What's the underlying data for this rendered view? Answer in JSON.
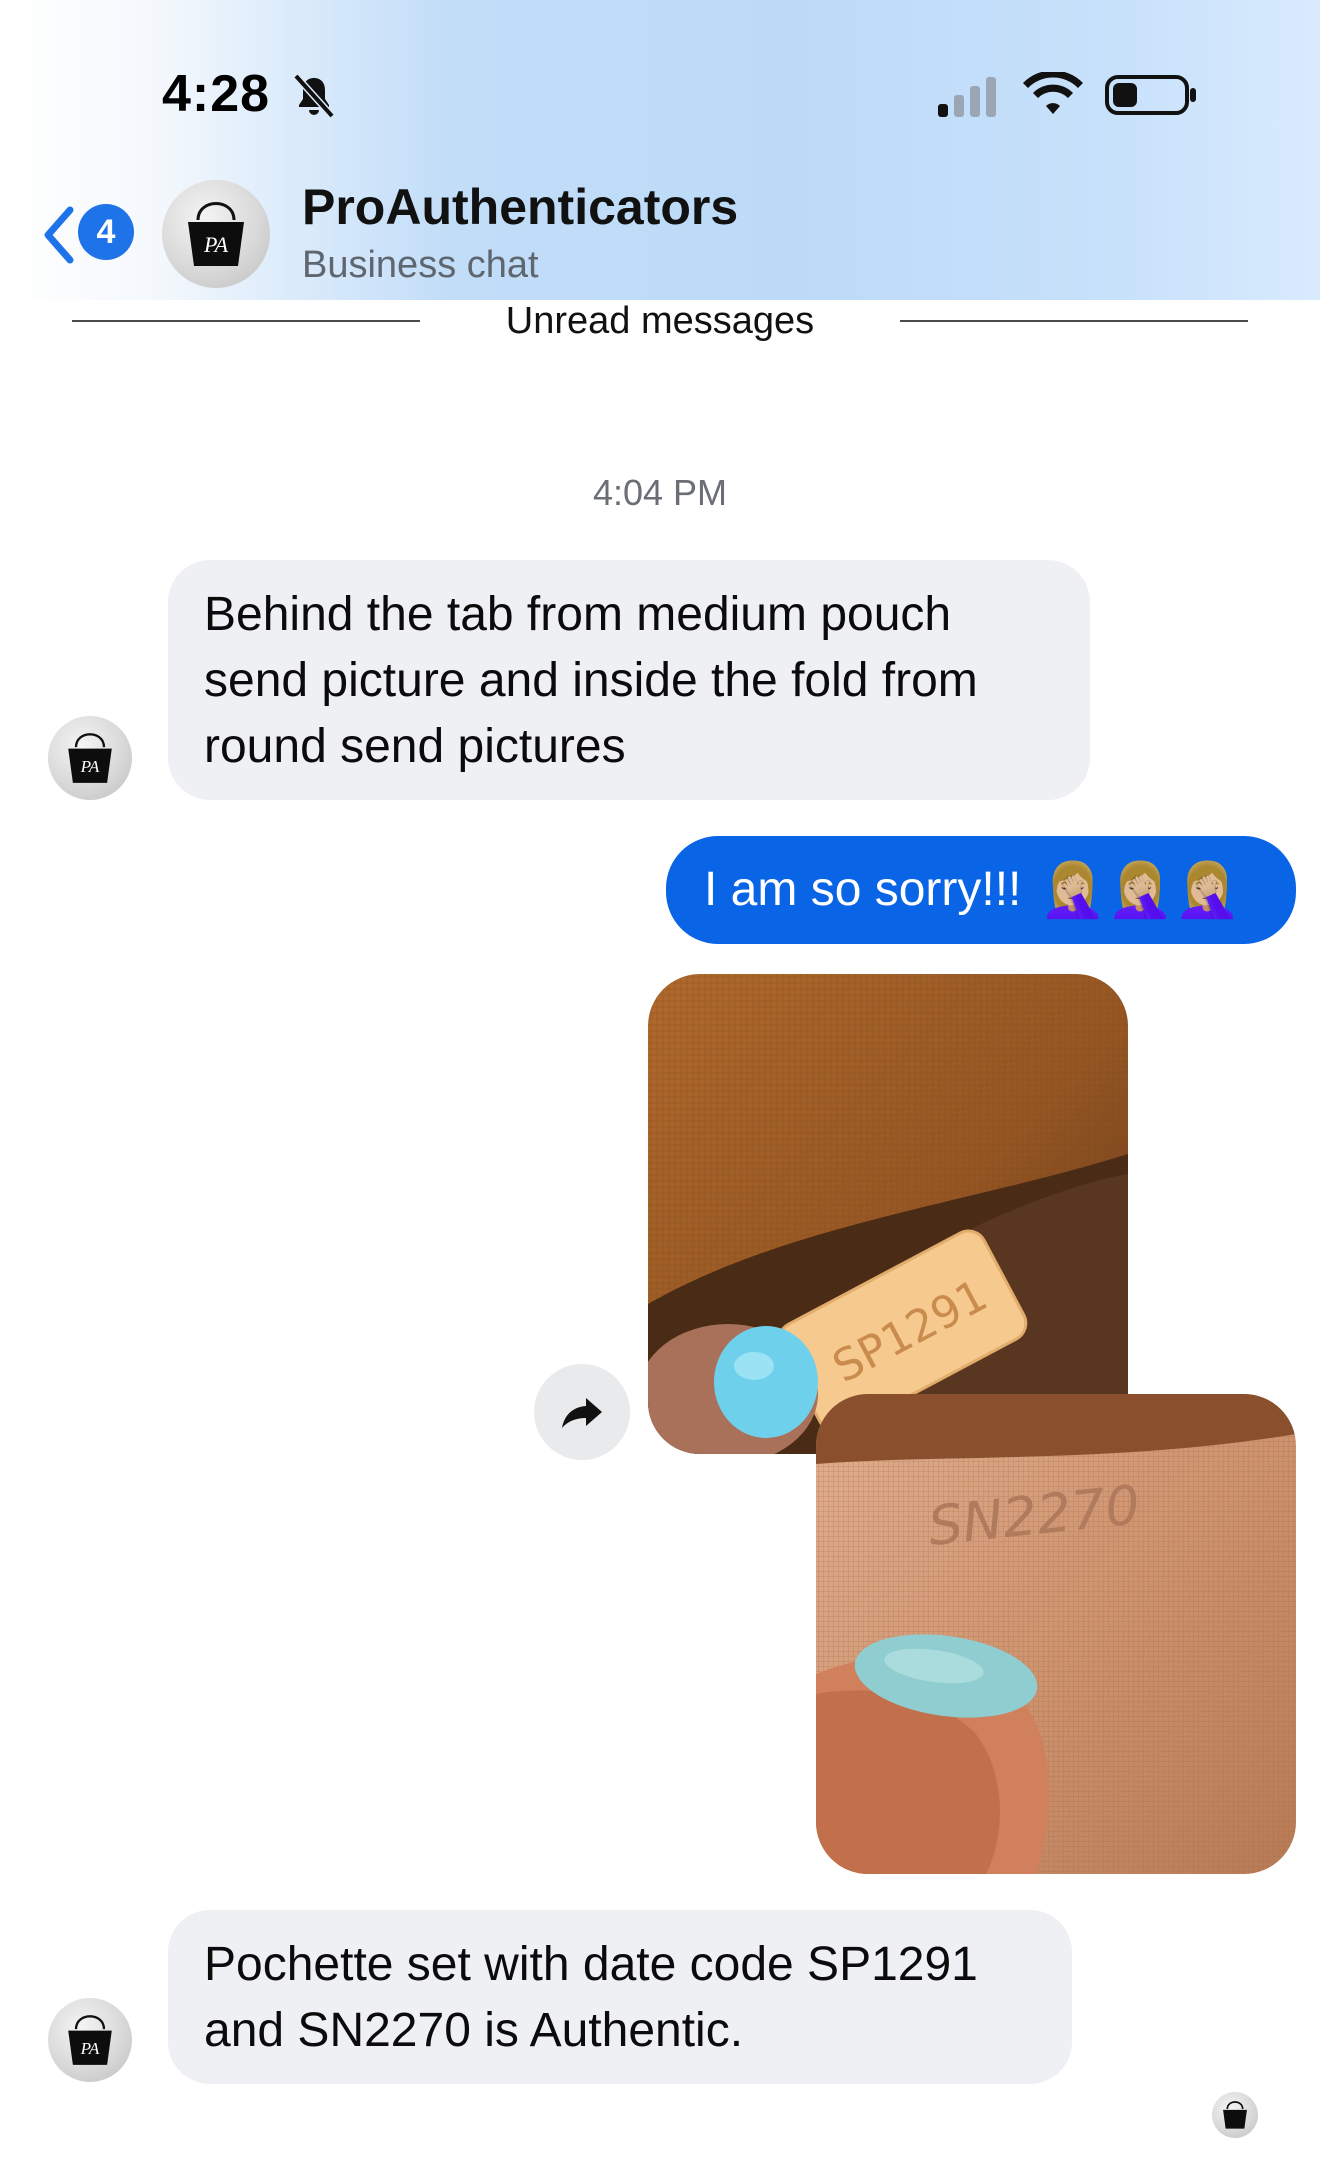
{
  "status_bar": {
    "time": "4:28",
    "icons": [
      "bell-slash-icon",
      "cellular-signal-icon",
      "wifi-icon",
      "battery-icon"
    ]
  },
  "header": {
    "back_badge_count": "4",
    "contact_name": "ProAuthenticators",
    "subtitle": "Business chat",
    "avatar_monogram": "PA"
  },
  "divider": {
    "label": "Unread messages"
  },
  "conversation": {
    "timestamp": "4:04 PM",
    "messages": [
      {
        "direction": "incoming",
        "lines": [
          "Behind the tab from medium pouch",
          "send picture and inside the fold from",
          "round send pictures"
        ]
      },
      {
        "direction": "outgoing",
        "text": "I am so sorry!!!",
        "emoji": "🤦🏼‍♀️🤦🏼‍♀️🤦🏼‍♀️"
      },
      {
        "direction": "outgoing",
        "type": "photo",
        "stamp_text": "SP1291"
      },
      {
        "direction": "outgoing",
        "type": "photo",
        "stamp_text": "SN2270"
      },
      {
        "direction": "incoming",
        "lines": [
          "Pochette set with date code SP1291",
          "and SN2270 is Authentic."
        ]
      }
    ]
  },
  "colors": {
    "outgoing_bubble": "#0a64e6",
    "incoming_bubble": "#eef0f3",
    "badge": "#1e73e8"
  }
}
